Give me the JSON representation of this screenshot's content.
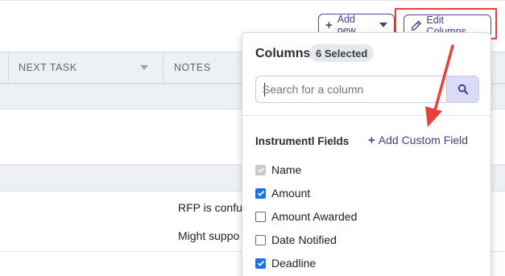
{
  "toolbar": {
    "add_new_label": "Add new",
    "edit_columns_label": "Edit Columns"
  },
  "table": {
    "headers": [
      "NEXT TASK",
      "NOTES"
    ],
    "notes": [
      "RFP is confus",
      "Might suppo"
    ]
  },
  "columns_panel": {
    "title": "Columns",
    "selected_badge": "6 Selected",
    "search_placeholder": "Search for a column",
    "section_title": "Instrumentl Fields",
    "add_custom_field_label": "Add Custom Field",
    "fields": [
      {
        "label": "Name",
        "state": "disabled-checked"
      },
      {
        "label": "Amount",
        "state": "checked"
      },
      {
        "label": "Amount Awarded",
        "state": "unchecked"
      },
      {
        "label": "Date Notified",
        "state": "unchecked"
      },
      {
        "label": "Deadline",
        "state": "checked"
      }
    ]
  },
  "colors": {
    "accent": "#3f4288",
    "highlight": "#e8413c",
    "checkbox": "#1a73e8"
  },
  "icons": [
    "plus-icon",
    "caret-down-icon",
    "pencil-icon",
    "search-icon",
    "check-icon",
    "arrow-annotation"
  ]
}
